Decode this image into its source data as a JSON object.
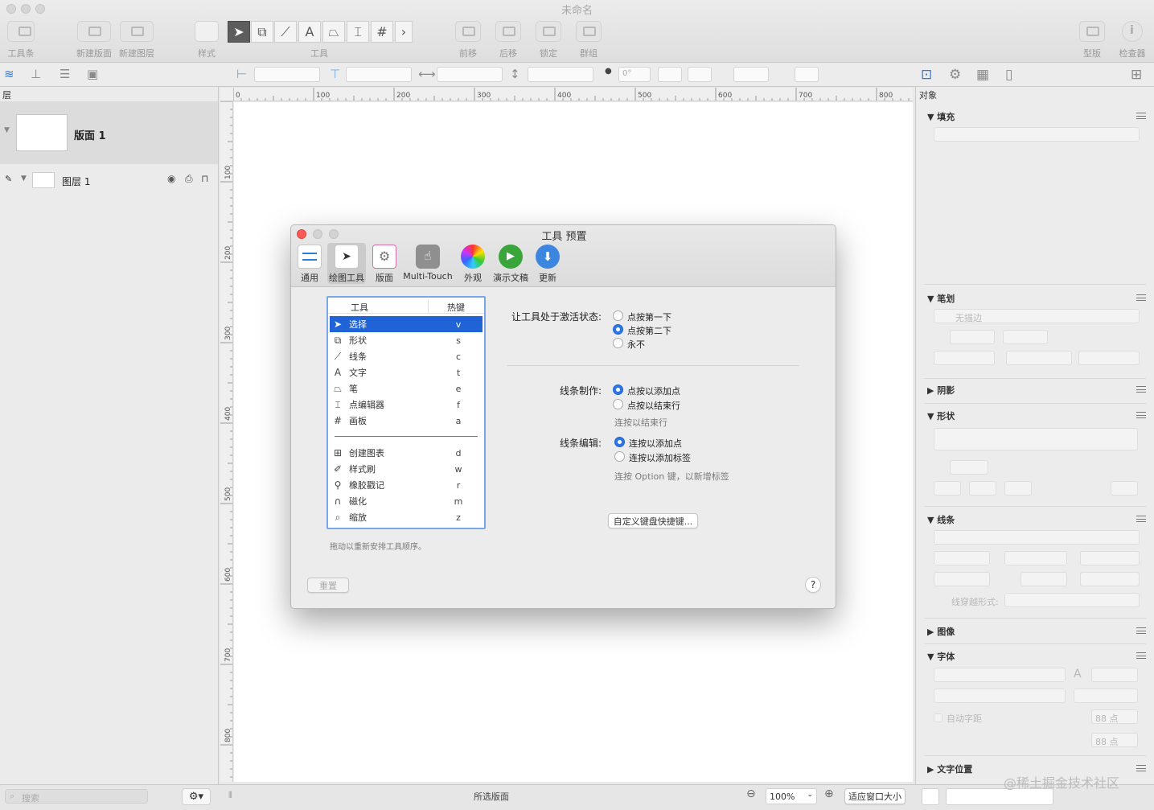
{
  "window": {
    "title": "未命名"
  },
  "toolbar": {
    "toolbar_label": "工具条",
    "new_canvas": "新建版面",
    "new_layer": "新建图层",
    "style": "样式",
    "tools": "工具",
    "forward": "前移",
    "backward": "后移",
    "lock": "锁定",
    "group": "群组",
    "stencil": "型版",
    "inspector": "检查器"
  },
  "toolbar2": {
    "angle": "0°"
  },
  "left": {
    "layers_title": "层",
    "canvas_name": "版面 1",
    "layer_name": "图层 1"
  },
  "ruler": {
    "h": [
      "0",
      "100",
      "200",
      "300",
      "400",
      "500",
      "600",
      "700",
      "800"
    ],
    "v": [
      "100",
      "200",
      "300",
      "400",
      "500",
      "600",
      "700",
      "800"
    ]
  },
  "right": {
    "object": "对象",
    "fill": "填充",
    "stroke": "笔划",
    "no_stroke": "无描边",
    "shadow": "阴影",
    "shape": "形状",
    "lines": "线条",
    "line_label": "线穿越形式:",
    "image": "图像",
    "font": "字体",
    "auto_kern": "自动字距",
    "pt1": "88 点",
    "pt2": "88 点",
    "text_pos": "文字位置"
  },
  "status": {
    "search_placeholder": "搜索",
    "selection": "所选版面",
    "zoom": "100%",
    "fit": "适应窗口大小",
    "watermark": "@稀土掘金技术社区"
  },
  "dialog": {
    "title": "工具 预置",
    "tabs": [
      "通用",
      "绘图工具",
      "版面",
      "Multi-Touch",
      "外观",
      "演示文稿",
      "更新"
    ],
    "list_header_tool": "工具",
    "list_header_key": "热键",
    "tools": [
      {
        "icon": "arrow",
        "name": "选择",
        "key": "v"
      },
      {
        "icon": "shape",
        "name": "形状",
        "key": "s"
      },
      {
        "icon": "line",
        "name": "线条",
        "key": "c"
      },
      {
        "icon": "text",
        "name": "文字",
        "key": "t"
      },
      {
        "icon": "pen",
        "name": "笔",
        "key": "e"
      },
      {
        "icon": "point",
        "name": "点编辑器",
        "key": "f"
      },
      {
        "icon": "grid",
        "name": "画板",
        "key": "a"
      }
    ],
    "tools2": [
      {
        "icon": "diagram",
        "name": "创建图表",
        "key": "d"
      },
      {
        "icon": "brush",
        "name": "样式刷",
        "key": "w"
      },
      {
        "icon": "stamp",
        "name": "橡胶戳记",
        "key": "r"
      },
      {
        "icon": "magnet",
        "name": "磁化",
        "key": "m"
      },
      {
        "icon": "zoom",
        "name": "缩放",
        "key": "z"
      }
    ],
    "drag_note": "拖动以重新安排工具顺序。",
    "activate_label": "让工具处于激活状态:",
    "activate_opts": [
      "点按第一下",
      "点按第二下",
      "永不"
    ],
    "line_make_label": "线条制作:",
    "line_make_opts": [
      "点按以添加点",
      "点按以结束行"
    ],
    "line_make_note": "连按以结束行",
    "line_edit_label": "线条编辑:",
    "line_edit_opts": [
      "连按以添加点",
      "连按以添加标签"
    ],
    "line_edit_note": "连按 Option 键，以新增标签",
    "custom_btn": "自定义键盘快捷键...",
    "reset_btn": "重置",
    "help": "?"
  }
}
